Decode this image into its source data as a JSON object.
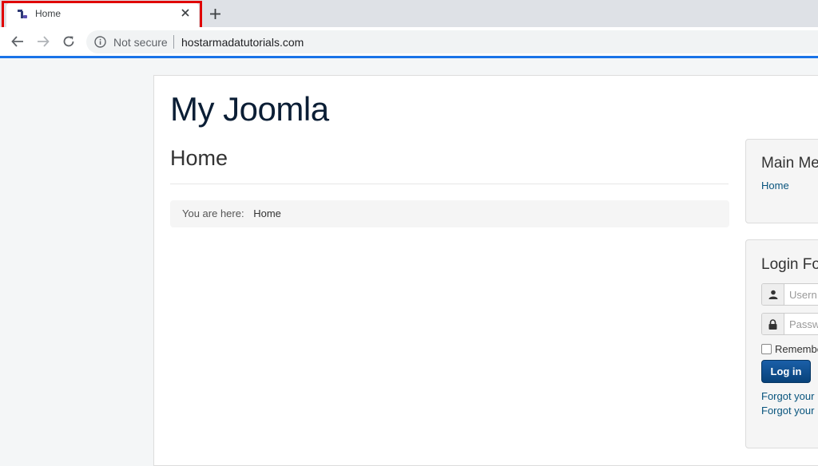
{
  "browser": {
    "tab_title": "Home",
    "security_label": "Not secure",
    "url": "hostarmadatutorials.com"
  },
  "site": {
    "title": "My Joomla",
    "page_heading": "Home",
    "breadcrumb_prefix": "You are here:",
    "breadcrumb_current": "Home"
  },
  "main_menu": {
    "title": "Main Me",
    "items": [
      {
        "label": "Home"
      }
    ]
  },
  "login_form": {
    "title": "Login Fo",
    "username_placeholder": "Usern",
    "password_placeholder": "Passw",
    "remember_label": "Remembe",
    "login_label": "Log in",
    "forgot_password": "Forgot your",
    "forgot_username": "Forgot your"
  },
  "colors": {
    "highlight": "#e00000",
    "link": "#08547d",
    "button": "#08427a",
    "loadbar": "#1a73e8"
  }
}
